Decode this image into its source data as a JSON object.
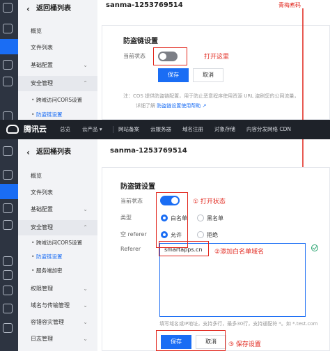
{
  "top": {
    "back_label": "返回桶列表",
    "bucket_name": "sanma-1253769514",
    "menu": [
      "概览",
      "文件列表",
      "基础配置",
      "安全管理"
    ],
    "submenu": [
      "跨域访问CORS设置",
      "防盗链设置"
    ],
    "card_title": "防盗链设置",
    "status_label": "当前状态",
    "annotation_toggle": "打开这里",
    "save_label": "保存",
    "cancel_label": "取消",
    "note_text": "注：COS 提供防盗链配置，用于防止恶意程序使用资源 URL 盗刷您的公网流量，",
    "note_more": "详细了解",
    "note_link": "防盗链设置使用帮助",
    "side_annotation": "青梅煮码"
  },
  "topbar": {
    "brand": "腾讯云",
    "nav": [
      "总览",
      "云产品",
      "网站备案",
      "云服务器",
      "域名注册",
      "对象存储",
      "内容分发网络 CDN"
    ]
  },
  "bottom": {
    "back_label": "返回桶列表",
    "bucket_name": "sanma-1253769514",
    "menu": [
      "概览",
      "文件列表",
      "基础配置",
      "安全管理"
    ],
    "submenu": [
      "跨域访问CORS设置",
      "防盗链设置",
      "服务端加密"
    ],
    "menu_more": [
      "权限管理",
      "域名与传输管理",
      "容错容灾管理",
      "日志管理"
    ],
    "card_title": "防盗链设置",
    "status_label": "当前状态",
    "type_label": "类型",
    "type_options": [
      "白名单",
      "黑名单"
    ],
    "empty_referer_label": "空 referer",
    "empty_referer_options": [
      "允许",
      "拒绝"
    ],
    "referer_label": "Referer",
    "referer_value": "smartapps.cn",
    "help_text": "填写域名或IP地址，支持多行，最多30行，支持通配符 *。如 *.test.com",
    "save_label": "保存",
    "cancel_label": "取消",
    "annotation_1": "① 打开状态",
    "annotation_2": "②添加白名单域名",
    "annotation_3": "③ 保存设置"
  },
  "colors": {
    "accent": "#1a6df4",
    "annotation": "#e1261c",
    "rail": "#2d3441",
    "topbar": "#1e2229"
  }
}
